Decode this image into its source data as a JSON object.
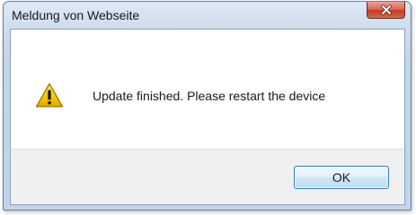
{
  "window": {
    "title": "Meldung von Webseite"
  },
  "dialog": {
    "message": "Update finished. Please restart the device",
    "icon": "warning-icon"
  },
  "buttons": {
    "close_icon": "close-icon",
    "ok_label": "OK"
  },
  "colors": {
    "title_bar": "#cfdced",
    "close_button": "#c13b22",
    "warning_yellow": "#f5c400",
    "ok_border": "#3c7fb1",
    "footer": "#f0f0f0"
  }
}
